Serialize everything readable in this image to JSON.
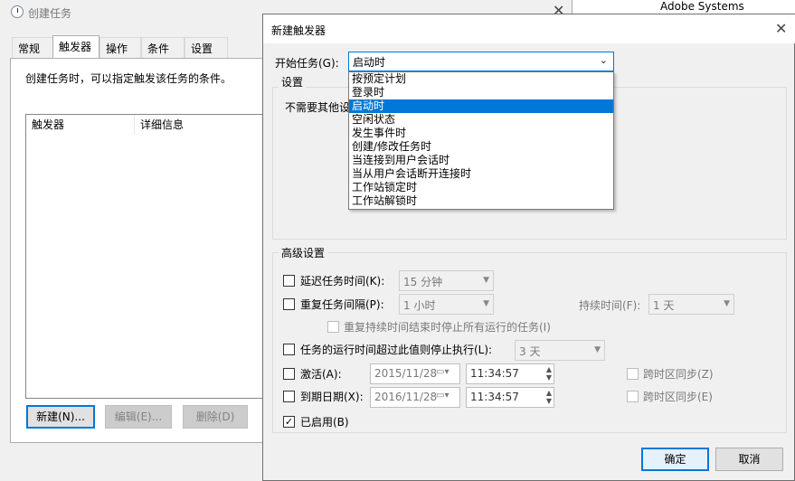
{
  "background_text": "Adobe Systems Incorpora",
  "parent": {
    "title": "创建任务",
    "tabs": [
      {
        "label": "常规"
      },
      {
        "label": "触发器"
      },
      {
        "label": "操作"
      },
      {
        "label": "条件"
      },
      {
        "label": "设置"
      }
    ],
    "description": "创建任务时，可以指定触发该任务的条件。",
    "columns": [
      "触发器",
      "详细信息"
    ],
    "buttons": {
      "new": "新建(N)...",
      "edit": "编辑(E)...",
      "delete": "删除(D)"
    }
  },
  "dialog": {
    "title": "新建触发器",
    "begin_label": "开始任务(G):",
    "begin_value": "启动时",
    "settings_label": "设置",
    "settings_text": "不需要其他设",
    "dropdown_options": [
      {
        "label": "按预定计划"
      },
      {
        "label": "登录时"
      },
      {
        "label": "启动时",
        "selected": true
      },
      {
        "label": "空闲状态"
      },
      {
        "label": "发生事件时"
      },
      {
        "label": "创建/修改任务时"
      },
      {
        "label": "当连接到用户会话时"
      },
      {
        "label": "当从用户会话断开连接时"
      },
      {
        "label": "工作站锁定时"
      },
      {
        "label": "工作站解锁时"
      }
    ],
    "advanced": {
      "label": "高级设置",
      "delay_label": "延迟任务时间(K):",
      "delay_value": "15 分钟",
      "repeat_label": "重复任务间隔(P):",
      "repeat_value": "1 小时",
      "duration_label": "持续时间(F):",
      "duration_value": "1 天",
      "stop_all_label": "重复持续时间结束时停止所有运行的任务(I)",
      "stop_if_label": "任务的运行时间超过此值则停止执行(L):",
      "stop_if_value": "3 天",
      "activate_label": "激活(A):",
      "activate_date": "2015/11/28",
      "activate_time": "11:34:57",
      "sync1_label": "跨时区同步(Z)",
      "expire_label": "到期日期(X):",
      "expire_date": "2016/11/28",
      "expire_time": "11:34:57",
      "sync2_label": "跨时区同步(E)",
      "enabled_label": "已启用(B)",
      "enabled": true
    },
    "ok": "确定",
    "cancel": "取消"
  }
}
